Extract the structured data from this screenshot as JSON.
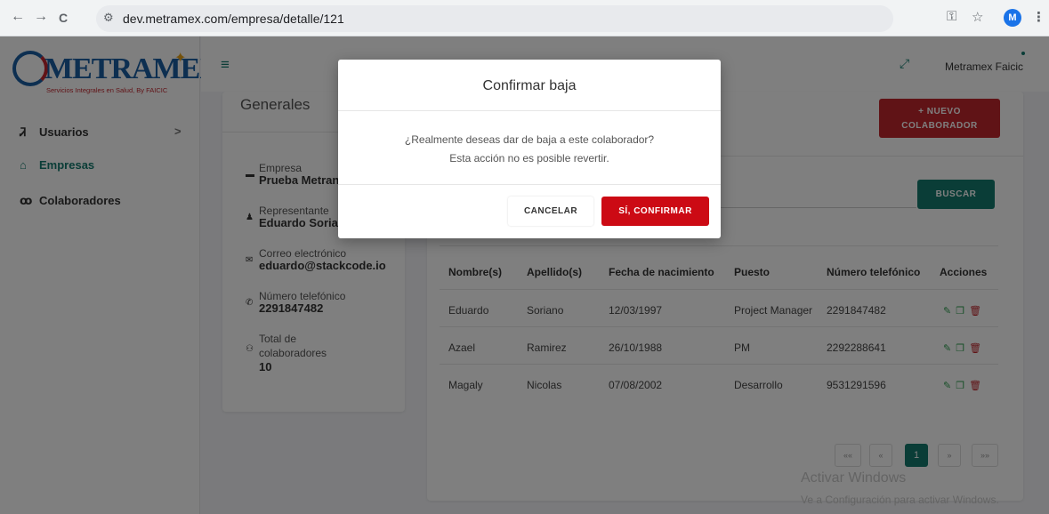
{
  "browser": {
    "url": "dev.metramex.com/empresa/detalle/121",
    "profile_initial": "M",
    "back_icon": "←",
    "forward_icon": "→",
    "reload_icon": "C",
    "tune_icon": "⚙",
    "key_icon": "⚿",
    "star_icon": "☆",
    "menu_icon": "⋮"
  },
  "sidebar": {
    "logo_text": "METRAMEX",
    "logo_tagline": "Servicios Integrales en Salud, By FAICIC",
    "items": [
      {
        "label": "Usuarios",
        "icon": "user-icon",
        "glyph": "Ꮨ",
        "chevron": ">"
      },
      {
        "label": "Empresas",
        "icon": "building-icon",
        "glyph": "⌂"
      },
      {
        "label": "Colaboradores",
        "icon": "users-icon",
        "glyph": "ꝏ"
      }
    ]
  },
  "topbar": {
    "hamburger": "≡",
    "expand": "⤢",
    "user_name": "Metramex Faicic"
  },
  "generales": {
    "title": "Generales",
    "fields": [
      {
        "label": "Empresa",
        "value": "Prueba Metran",
        "icon": "briefcase-icon",
        "glyph": "▬"
      },
      {
        "label": "Representante",
        "value": "Eduardo Soria",
        "icon": "person-icon",
        "glyph": "♟"
      },
      {
        "label": "Correo electrónico",
        "value": "eduardo@stackcode.io",
        "icon": "envelope-icon",
        "glyph": "✉"
      },
      {
        "label": "Número telefónico",
        "value": "2291847482",
        "icon": "phone-icon",
        "glyph": "✆"
      },
      {
        "label": "Total de",
        "label2": "colaboradores",
        "value": "10",
        "icon": "group-icon",
        "glyph": "⚇"
      }
    ]
  },
  "main": {
    "nuevo_plus": "+",
    "nuevo_line1": "NUEVO",
    "nuevo_line2": "COLABORADOR",
    "buscar_label": "BUSCAR",
    "table": {
      "headers": [
        "Nombre(s)",
        "Apellido(s)",
        "Fecha de nacimiento",
        "Puesto",
        "Número telefónico",
        "Acciones"
      ],
      "rows": [
        [
          "Eduardo",
          "Soriano",
          "12/03/1997",
          "Project Manager",
          "2291847482"
        ],
        [
          "Azael",
          "Ramirez",
          "26/10/1988",
          "PM",
          "2292288641"
        ],
        [
          "Magaly",
          "Nicolas",
          "07/08/2002",
          "Desarrollo",
          "9531291596"
        ]
      ],
      "action_icons": {
        "edit": "✎",
        "copy": "❐",
        "delete": "🗑"
      }
    },
    "pagination": {
      "first": "««",
      "prev": "«",
      "current": "1",
      "next": "»",
      "last": "»»"
    }
  },
  "watermark": {
    "line1": "Activar Windows",
    "line2": "Ve a Configuración para activar Windows."
  },
  "modal": {
    "title": "Confirmar baja",
    "message_line1": "¿Realmente deseas dar de baja a este colaborador?",
    "message_line2": "Esta acción no es posible revertir.",
    "cancel_label": "CANCELAR",
    "confirm_label": "SÍ, CONFIRMAR"
  },
  "colors": {
    "primary_teal": "#157a6e",
    "danger_red": "#cc0a14",
    "brand_blue": "#1a5fa3"
  }
}
